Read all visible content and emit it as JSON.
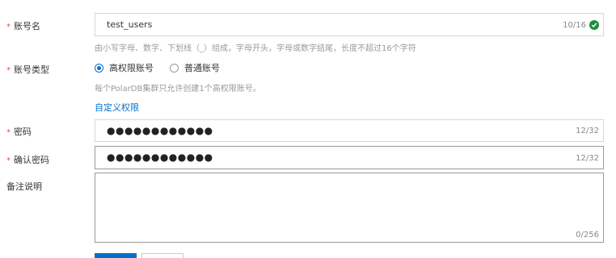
{
  "form": {
    "account_name": {
      "label": "账号名",
      "value": "test_users",
      "count": "10/16",
      "hint": "由小写字母、数字、下划线（_）组成，字母开头，字母或数字结尾，长度不超过16个字符"
    },
    "account_type": {
      "label": "账号类型",
      "options": [
        {
          "label": "高权限账号",
          "checked": true
        },
        {
          "label": "普通账号",
          "checked": false
        }
      ],
      "hint": "每个PolarDB集群只允许创建1个高权限账号。",
      "custom_link": "自定义权限"
    },
    "password": {
      "label": "密码",
      "value": "●●●●●●●●●●●●",
      "count": "12/32"
    },
    "confirm_password": {
      "label": "确认密码",
      "value": "●●●●●●●●●●●●",
      "count": "12/32"
    },
    "remarks": {
      "label": "备注说明",
      "count": "0/256"
    },
    "required_mark": "*"
  },
  "colors": {
    "primary": "#0070cc",
    "required": "#e84f3d",
    "success": "#1e8e3e"
  },
  "icons": {
    "valid": "check-circle-icon"
  }
}
